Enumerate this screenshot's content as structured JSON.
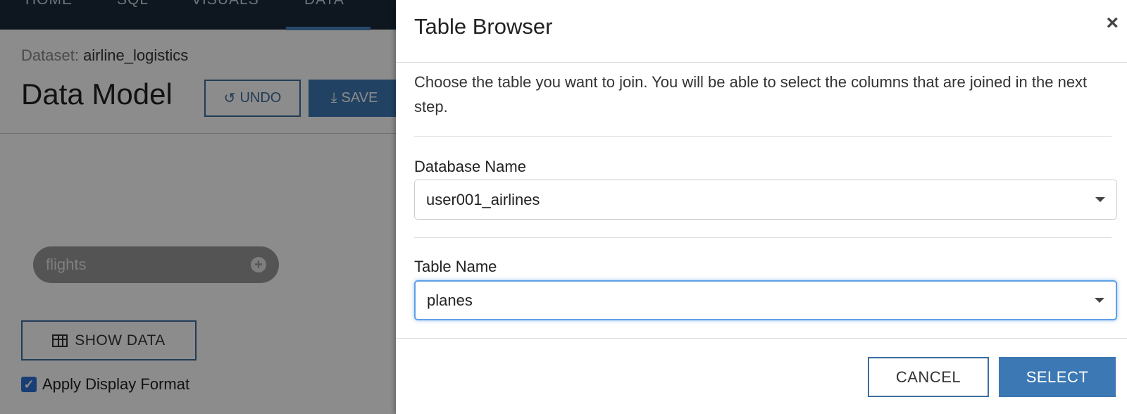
{
  "topnav": {
    "items": [
      "HOME",
      "SQL",
      "VISUALS",
      "DATA"
    ]
  },
  "header": {
    "dataset_label": "Dataset:",
    "dataset_name": "airline_logistics",
    "title": "Data Model",
    "undo_label": "UNDO",
    "save_label": "SAVE"
  },
  "canvas": {
    "table_pill": "flights"
  },
  "footer_controls": {
    "show_data_label": "SHOW DATA",
    "apply_format_label": "Apply Display Format",
    "apply_format_checked": true
  },
  "modal": {
    "title": "Table Browser",
    "close_glyph": "×",
    "description": "Choose the table you want to join. You will be able to select the columns that are joined in the next step.",
    "database": {
      "label": "Database Name",
      "value": "user001_airlines"
    },
    "table": {
      "label": "Table Name",
      "value": "planes"
    },
    "cancel_label": "CANCEL",
    "select_label": "SELECT"
  },
  "colors": {
    "nav_bg": "#1b2a3a",
    "primary": "#3c78b3",
    "focus": "#5fa0e6"
  },
  "icons": [
    "undo-icon",
    "save-icon",
    "add-circle-icon",
    "grid-icon",
    "checkbox-checked-icon",
    "close-icon",
    "caret-down-icon"
  ]
}
